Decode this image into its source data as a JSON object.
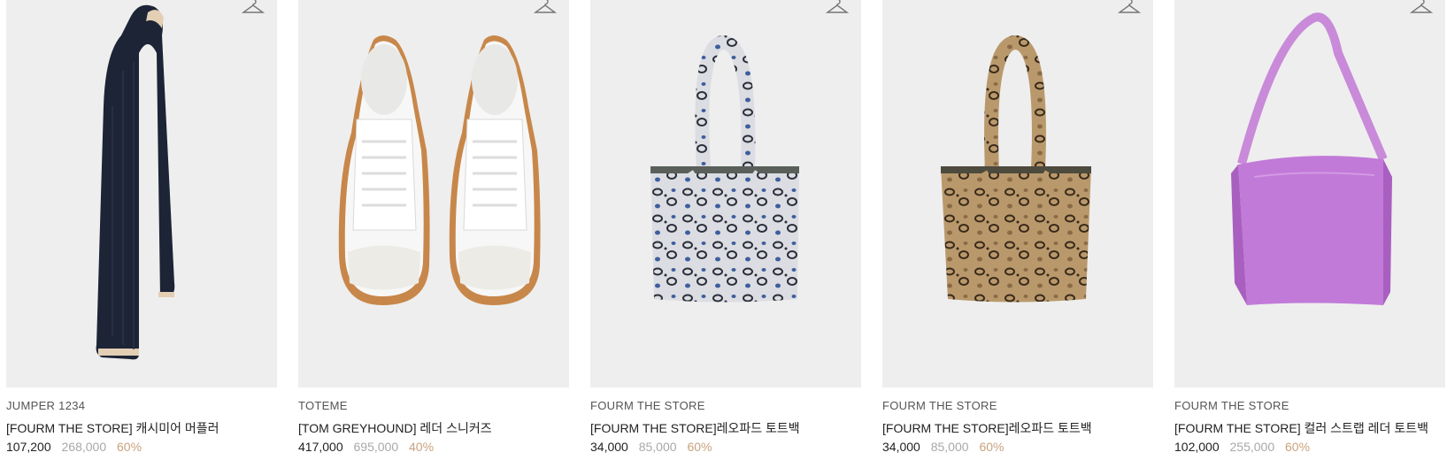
{
  "products": [
    {
      "brand": "JUMPER 1234",
      "name": "[FOURM THE STORE] 캐시미어 머플러",
      "sale_price": "107,200",
      "original_price": "268,000",
      "discount": "60%",
      "image": "navy-cashmere-muffler"
    },
    {
      "brand": "TOTEME",
      "name": "[TOM GREYHOUND] 레더 스니커즈",
      "sale_price": "417,000",
      "original_price": "695,000",
      "discount": "40%",
      "image": "white-leather-sneakers"
    },
    {
      "brand": "FOURM THE STORE",
      "name": "[FOURM THE STORE]레오파드 토트백",
      "sale_price": "34,000",
      "original_price": "85,000",
      "discount": "60%",
      "image": "blue-leopard-tote-bag"
    },
    {
      "brand": "FOURM THE STORE",
      "name": "[FOURM THE STORE]레오파드 토트백",
      "sale_price": "34,000",
      "original_price": "85,000",
      "discount": "60%",
      "image": "beige-leopard-tote-bag"
    },
    {
      "brand": "FOURM THE STORE",
      "name": "[FOURM THE STORE] 컬러 스트랩 레더 토트백",
      "sale_price": "102,000",
      "original_price": "255,000",
      "discount": "60%",
      "image": "purple-leather-tote-bag"
    }
  ],
  "colors": {
    "image_bg": "#eeeeee",
    "sale_price": "#222222",
    "original_price": "#a8a8a8",
    "discount": "#c9a27e"
  },
  "icons": {
    "wishlist": "hanger-icon"
  }
}
